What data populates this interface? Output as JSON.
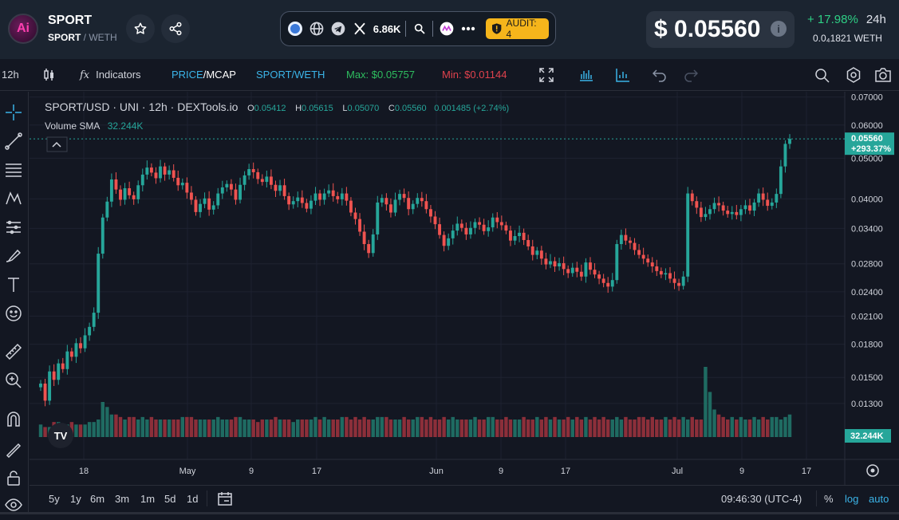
{
  "header": {
    "logo_text": "Ai",
    "token_name": "SPORT",
    "token_symbol": "SPORT",
    "quote_sep": " / WETH",
    "social_count": "6.86K",
    "audit_label": "AUDIT: 4",
    "price": "$ 0.05560",
    "change": "+ 17.98%",
    "change_period": "24h",
    "eth_price": "0.0₄1821 WETH",
    "colors": {
      "positive": "#2ecf85",
      "audit_bg": "#f5b51b"
    }
  },
  "toolbar": {
    "interval": "12h",
    "indicators_label": "Indicators",
    "price_label": "PRICE",
    "mcap_label": "/MCAP",
    "pair_label": "SPORT/WETH",
    "max_label": "Max: $0.05757",
    "min_label": "Min: $0.01144"
  },
  "legend": {
    "symbol": "SPORT/USD · UNI · 12h · DEXTools.io",
    "o_key": "O",
    "o_val": "0.05412",
    "h_key": "H",
    "h_val": "0.05615",
    "l_key": "L",
    "l_val": "0.05070",
    "c_key": "C",
    "c_val": "0.05560",
    "chg": "0.001485 (+2.74%)",
    "sma_label": "Volume SMA",
    "sma_val": "32.244K"
  },
  "bottom": {
    "timeframes": [
      "5y",
      "1y",
      "6m",
      "3m",
      "1m",
      "5d",
      "1d"
    ],
    "time": "09:46:30 (UTC-4)",
    "percent": "%",
    "log": "log",
    "auto": "auto"
  },
  "chart_data": {
    "type": "candlestick",
    "y_ticks": [
      "0.07000",
      "0.06000",
      "0.05000",
      "0.04000",
      "0.03400",
      "0.02800",
      "0.02400",
      "0.02100",
      "0.01800",
      "0.01500",
      "0.01300"
    ],
    "x_ticks": [
      "18",
      "May",
      "9",
      "17",
      "Jun",
      "9",
      "17",
      "Jul",
      "9",
      "17"
    ],
    "scale": "log",
    "last_price_label": "0.05560",
    "last_change_label": "+293.37%",
    "volume_label": "32.244K",
    "watermark": "TV",
    "colors": {
      "up": "#26a69a",
      "down": "#ef5350"
    },
    "closes": [
      0.0145,
      0.0132,
      0.0155,
      0.0148,
      0.0162,
      0.0157,
      0.0173,
      0.0168,
      0.0181,
      0.0176,
      0.0189,
      0.0198,
      0.0214,
      0.0296,
      0.0361,
      0.0394,
      0.0445,
      0.0421,
      0.0398,
      0.0424,
      0.0408,
      0.0399,
      0.0431,
      0.0457,
      0.0475,
      0.0462,
      0.0448,
      0.0478,
      0.0457,
      0.0468,
      0.0449,
      0.0431,
      0.0437,
      0.0414,
      0.0398,
      0.0372,
      0.0389,
      0.0401,
      0.0377,
      0.0386,
      0.0412,
      0.0426,
      0.0434,
      0.0421,
      0.0398,
      0.0432,
      0.0455,
      0.0471,
      0.0463,
      0.0446,
      0.0439,
      0.0452,
      0.0432,
      0.0418,
      0.0431,
      0.0406,
      0.0388,
      0.0395,
      0.0403,
      0.0391,
      0.0379,
      0.0396,
      0.0412,
      0.0398,
      0.0412,
      0.0419,
      0.0406,
      0.0399,
      0.0412,
      0.0396,
      0.0371,
      0.0358,
      0.0334,
      0.0312,
      0.0297,
      0.0329,
      0.0392,
      0.0402,
      0.0388,
      0.0371,
      0.0398,
      0.0411,
      0.0402,
      0.0378,
      0.0389,
      0.0402,
      0.0395,
      0.0378,
      0.0363,
      0.0348,
      0.0328,
      0.0309,
      0.0322,
      0.0336,
      0.0349,
      0.0341,
      0.0329,
      0.0341,
      0.0352,
      0.0347,
      0.0335,
      0.0342,
      0.0361,
      0.0352,
      0.0346,
      0.0336,
      0.0318,
      0.0326,
      0.0332,
      0.0319,
      0.0308,
      0.0294,
      0.0301,
      0.0288,
      0.0279,
      0.0284,
      0.0276,
      0.0281,
      0.0272,
      0.0266,
      0.0274,
      0.0268,
      0.0261,
      0.0282,
      0.0271,
      0.0264,
      0.0258,
      0.0252,
      0.0247,
      0.0256,
      0.0312,
      0.0328,
      0.0318,
      0.0314,
      0.0302,
      0.0294,
      0.0288,
      0.0282,
      0.0276,
      0.0269,
      0.0264,
      0.0266,
      0.0258,
      0.0252,
      0.0248,
      0.0261,
      0.0412,
      0.0395,
      0.0381,
      0.0362,
      0.0368,
      0.0378,
      0.0391,
      0.0386,
      0.0375,
      0.0368,
      0.0372,
      0.0366,
      0.0378,
      0.0386,
      0.0375,
      0.0392,
      0.0412,
      0.0398,
      0.0385,
      0.0392,
      0.0411,
      0.0478,
      0.0541,
      0.0556
    ],
    "volumes": [
      5,
      4,
      4,
      6,
      6,
      5,
      5,
      6,
      5,
      5,
      5,
      6,
      6,
      7,
      14,
      12,
      9,
      9,
      8,
      7,
      8,
      8,
      7,
      8,
      7,
      8,
      7,
      7,
      7,
      7,
      7,
      7,
      8,
      8,
      8,
      7,
      7,
      7,
      7,
      7,
      8,
      7,
      7,
      7,
      8,
      8,
      7,
      7,
      7,
      6,
      7,
      7,
      7,
      8,
      7,
      7,
      7,
      6,
      7,
      7,
      7,
      7,
      8,
      7,
      8,
      7,
      7,
      7,
      8,
      8,
      7,
      8,
      7,
      8,
      7,
      7,
      8,
      8,
      8,
      7,
      7,
      7,
      8,
      7,
      7,
      8,
      8,
      7,
      8,
      7,
      7,
      8,
      7,
      8,
      7,
      7,
      7,
      7,
      8,
      7,
      7,
      8,
      8,
      7,
      7,
      8,
      7,
      7,
      7,
      8,
      7,
      7,
      8,
      7,
      8,
      7,
      8,
      7,
      7,
      8,
      7,
      8,
      7,
      8,
      7,
      8,
      7,
      8,
      7,
      7,
      8,
      7,
      8,
      7,
      7,
      8,
      8,
      7,
      8,
      7,
      7,
      8,
      7,
      8,
      7,
      8,
      7,
      8,
      7,
      7,
      28,
      18,
      11,
      9,
      8,
      7,
      8,
      7,
      8,
      7,
      7,
      8,
      7,
      8,
      7,
      8,
      8,
      7,
      8,
      9,
      7,
      8,
      9,
      8
    ]
  }
}
